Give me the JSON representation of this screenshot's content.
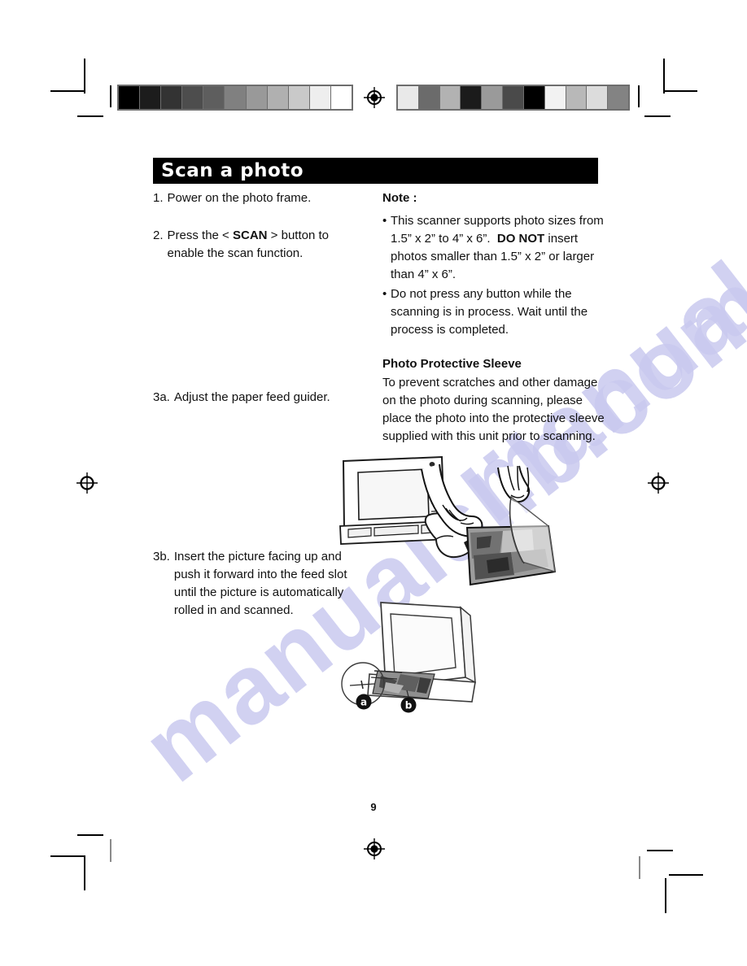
{
  "watermark": {
    "text": "manualslib.com",
    "color": "#c9c9ef"
  },
  "page": {
    "number": "9",
    "heading": "Scan a photo"
  },
  "left_column": {
    "step1": {
      "number": "1.",
      "text": "Power on the photo frame."
    },
    "step2": {
      "number": "2.",
      "text_before": "Press the <",
      "emphasis": "SCAN",
      "text_after": "> button to enable the scan function."
    },
    "step3a": {
      "number": "3a.",
      "text": "Adjust the paper feed guider."
    },
    "step3b": {
      "number": "3b.",
      "text": "Insert the picture facing up and push it forward into the feed slot until the picture is automatically rolled in and scanned."
    }
  },
  "right_column": {
    "note_heading": "Note :",
    "note_bullet_1_part1": "This scanner supports photo sizes from 1.5” x 2” to 4” x 6”.",
    "note_bullet_1_emphasis": "DO NOT",
    "note_bullet_1_part2": "insert photos smaller than 1.5” x 2” or larger than 4” x 6”.",
    "note_bullet_2": "Do not press any button while the scanning is in process. Wait until the process is completed.",
    "sleeve_heading": "Photo Protective Sleeve",
    "sleeve_text": "To prevent scratches and other damage on the photo during scanning, please place the photo into the protective sleeve supplied with this unit prior to scanning.",
    "bullet_glyph": "•"
  },
  "figures": {
    "frame_press": {
      "caption": "photo frame with hand pressing side button"
    },
    "tilted_frame": {
      "caption": "tilted photo frame with photo in feed slot",
      "callout_a": "a",
      "callout_b": "b"
    },
    "sleeve": {
      "caption": "two hands inserting photo into protective sleeve"
    }
  },
  "calibration": {
    "left_bar_label": "grayscale step wedge",
    "left_bar_swatches": [
      "#000000",
      "#1c1c1c",
      "#333333",
      "#4d4d4d",
      "#5e5e5e",
      "#808080",
      "#999999",
      "#b0b0b0",
      "#c9c9c9",
      "#eeeeee",
      "#ffffff"
    ],
    "right_bar_label": "scrambled gray control patches",
    "right_bar_swatches": [
      "#e9e9e9",
      "#6b6b6b",
      "#b2b2b2",
      "#1b1b1b",
      "#9a9a9a",
      "#4a4a4a",
      "#000000",
      "#f2f2f2",
      "#b8b8b8",
      "#dcdcdc",
      "#838383"
    ],
    "frame_color": "#6e6e6e"
  }
}
